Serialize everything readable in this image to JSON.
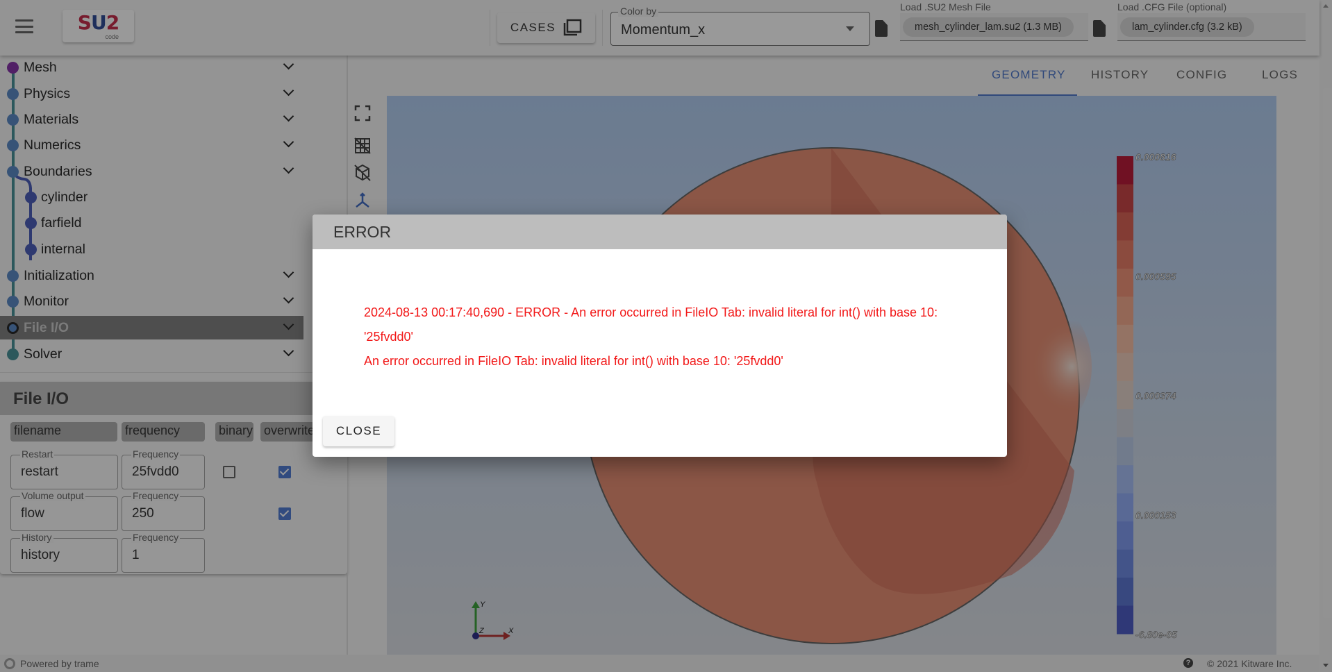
{
  "header": {
    "logo_text": "SU2",
    "logo_sub": "code",
    "cases_label": "CASES",
    "color_by": {
      "label": "Color by",
      "value": "Momentum_x"
    },
    "mesh_file": {
      "label": "Load .SU2 Mesh File",
      "value": "mesh_cylinder_lam.su2 (1.3 MB)"
    },
    "cfg_file": {
      "label": "Load .CFG File (optional)",
      "value": "lam_cylinder.cfg (3.2 kB)"
    }
  },
  "sidebar": {
    "items": [
      {
        "label": "Mesh",
        "color": "#7b1fa2"
      },
      {
        "label": "Physics",
        "color": "#4a7fc1"
      },
      {
        "label": "Materials",
        "color": "#4a7fc1"
      },
      {
        "label": "Numerics",
        "color": "#4a7fc1"
      },
      {
        "label": "Boundaries",
        "color": "#4a7fc1"
      },
      {
        "label": "cylinder",
        "color": "#3a4eb4"
      },
      {
        "label": "farfield",
        "color": "#3a4eb4"
      },
      {
        "label": "internal",
        "color": "#3a4eb4"
      },
      {
        "label": "Initialization",
        "color": "#4a7fc1"
      },
      {
        "label": "Monitor",
        "color": "#4a7fc1"
      },
      {
        "label": "File I/O",
        "color": "#4a7fc1",
        "selected": true
      },
      {
        "label": "Solver",
        "color": "#37888f"
      }
    ]
  },
  "fileio": {
    "title": "File I/O",
    "columns": [
      "filename",
      "frequency",
      "binary",
      "overwrite"
    ],
    "rows": [
      {
        "name_label": "Restart",
        "name": "restart",
        "freq_label": "Frequency",
        "freq": "25fvdd0",
        "binary": false,
        "overwrite": true
      },
      {
        "name_label": "Volume output",
        "name": "flow",
        "freq_label": "Frequency",
        "freq": "250",
        "overwrite": true
      },
      {
        "name_label": "History",
        "name": "history",
        "freq_label": "Frequency",
        "freq": "1"
      }
    ]
  },
  "tabs": [
    {
      "label": "GEOMETRY",
      "active": true
    },
    {
      "label": "HISTORY"
    },
    {
      "label": "CONFIG"
    },
    {
      "label": "LOGS"
    }
  ],
  "viewer": {
    "colorbar": {
      "labels": [
        "0.000816",
        "0.000595",
        "0.000374",
        "0.000153",
        "-6.80e-05"
      ],
      "colormap": [
        "#b40426",
        "#3b4cc0"
      ]
    },
    "axes": {
      "x": "X",
      "y": "Y",
      "z": "Z"
    }
  },
  "footer": {
    "powered": "Powered by trame",
    "copyright": "© 2021 Kitware Inc."
  },
  "dialog": {
    "title": "ERROR",
    "line1": "2024-08-13 00:17:40,690 - ERROR - An error occurred in FileIO Tab: invalid literal for int() with base 10: '25fvdd0'",
    "line2": "An error occurred in FileIO Tab: invalid literal for int() with base 10: '25fvdd0'",
    "close_label": "CLOSE"
  }
}
